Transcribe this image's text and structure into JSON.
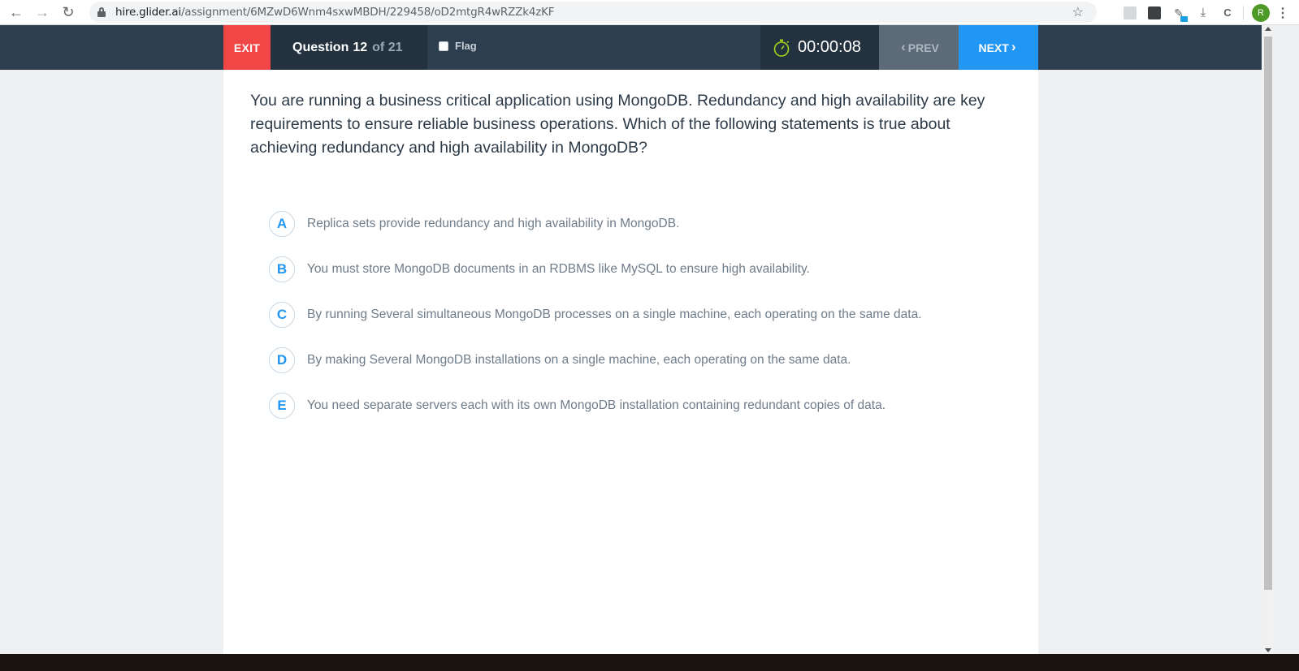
{
  "browser": {
    "url_host": "hire.glider.ai",
    "url_path": "/assignment/6MZwD6Wnm4sxwMBDH/229458/oD2mtgR4wRZZk4zKF",
    "avatar_letter": "R"
  },
  "header": {
    "exit_label": "EXIT",
    "question_label": "Question",
    "question_number": "12",
    "question_total": "of 21",
    "flag_label": "Flag",
    "timer": "00:00:08",
    "prev_label": "PREV",
    "next_label": "NEXT"
  },
  "question": {
    "text": "You are running a business critical application using MongoDB. Redundancy and high availability are key requirements to ensure reliable business operations. Which of the following statements is true about achieving redundancy and high availability in MongoDB?",
    "options": [
      {
        "letter": "A",
        "text": "Replica sets provide redundancy and high availability in MongoDB."
      },
      {
        "letter": "B",
        "text": "You must store MongoDB documents in an RDBMS like MySQL to ensure high availability."
      },
      {
        "letter": "C",
        "text": "By running Several simultaneous MongoDB processes on a single machine, each operating on the same data."
      },
      {
        "letter": "D",
        "text": "By making Several MongoDB installations on a single machine, each operating on the same data."
      },
      {
        "letter": "E",
        "text": "You need separate servers each with its own MongoDB installation containing redundant copies of data."
      }
    ]
  },
  "colors": {
    "header_bg": "#2d3e4f",
    "exit_bg": "#f04646",
    "next_bg": "#2196f3",
    "accent": "#2196f3",
    "timer_icon": "#a6d31a"
  }
}
